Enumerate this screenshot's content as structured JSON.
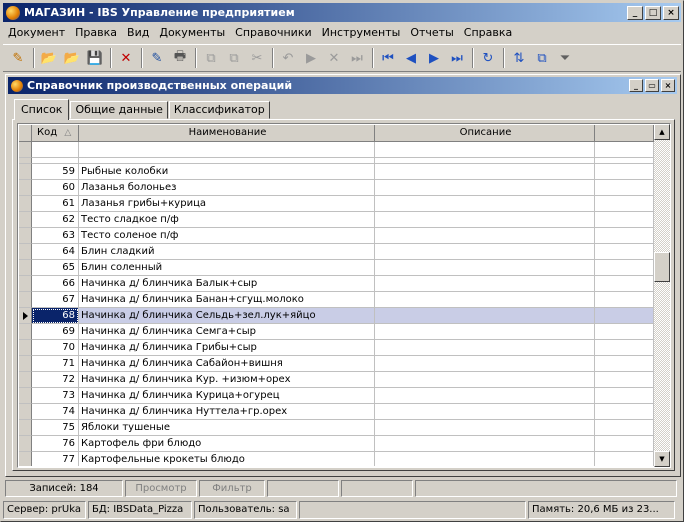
{
  "window": {
    "title": "МАГАЗИН - IBS Управление предприятием",
    "btn_min": "_",
    "btn_max": "□",
    "btn_close": "×"
  },
  "menu": [
    "Документ",
    "Правка",
    "Вид",
    "Документы",
    "Справочники",
    "Инструменты",
    "Отчеты",
    "Справка"
  ],
  "child": {
    "title": "Справочник производственных операций",
    "btn_min": "_",
    "btn_max": "▭",
    "btn_close": "×"
  },
  "tabs": [
    "Список",
    "Общие данные",
    "Классификатор"
  ],
  "table": {
    "headers": {
      "kod": "Код",
      "name": "Наименование",
      "desc": "Описание"
    },
    "rows": [
      {
        "kod": "59",
        "name": "Рыбные колобки",
        "desc": ""
      },
      {
        "kod": "60",
        "name": "Лазанья болоньез",
        "desc": ""
      },
      {
        "kod": "61",
        "name": "Лазанья грибы+курица",
        "desc": ""
      },
      {
        "kod": "62",
        "name": "Тесто сладкое п/ф",
        "desc": ""
      },
      {
        "kod": "63",
        "name": "Тесто соленое п/ф",
        "desc": ""
      },
      {
        "kod": "64",
        "name": "Блин сладкий",
        "desc": ""
      },
      {
        "kod": "65",
        "name": "Блин соленный",
        "desc": ""
      },
      {
        "kod": "66",
        "name": "Начинка д/ блинчика Балык+сыр",
        "desc": ""
      },
      {
        "kod": "67",
        "name": "Начинка д/ блинчика Банан+сгущ.молоко",
        "desc": ""
      },
      {
        "kod": "68",
        "name": "Начинка д/ блинчика Сельдь+зел.лук+яйцо",
        "desc": ""
      },
      {
        "kod": "69",
        "name": "Начинка д/ блинчика Семга+сыр",
        "desc": ""
      },
      {
        "kod": "70",
        "name": "Начинка д/ блинчика Грибы+сыр",
        "desc": ""
      },
      {
        "kod": "71",
        "name": "Начинка д/ блинчика Сабайон+вишня",
        "desc": ""
      },
      {
        "kod": "72",
        "name": "Начинка д/ блинчика Кур. +изюм+орех",
        "desc": ""
      },
      {
        "kod": "73",
        "name": "Начинка д/ блинчика Курица+огурец",
        "desc": ""
      },
      {
        "kod": "74",
        "name": "Начинка д/ блинчика Нуттела+гр.орех",
        "desc": ""
      },
      {
        "kod": "75",
        "name": "Яблоки тушеные",
        "desc": ""
      },
      {
        "kod": "76",
        "name": "Картофель фри блюдо",
        "desc": ""
      },
      {
        "kod": "77",
        "name": "Картофельные крокеты блюдо",
        "desc": ""
      }
    ],
    "selected_kod": "68",
    "scroll_position": 0.4
  },
  "status1": {
    "records": "Записей: 184",
    "view": "Просмотр",
    "filter": "Фильтр"
  },
  "status2": {
    "server": "Сервер: prUka",
    "db": "БД: IBSData_Pizza",
    "user": "Пользователь: sa",
    "memory": "Память: 20,6 МБ из 23..."
  },
  "icons": {
    "scroll_up": "▲",
    "scroll_down": "▼",
    "sort": "△"
  },
  "toolbar_glyphs": {
    "new": "✎",
    "open": "📂",
    "save": "💾",
    "delete": "✕",
    "print": "🖶",
    "copy": "⧉",
    "paste": "📋",
    "cut": "✂",
    "undo": "↶",
    "first": "⏮",
    "prev": "◀",
    "next": "▶",
    "last": "⏭",
    "refresh": "↻",
    "sort": "⇅",
    "filter": "⏷"
  },
  "colors": {
    "titlebar_start": "#0a246a",
    "titlebar_end": "#a6caf0",
    "selected_row": "#c9cde6"
  }
}
